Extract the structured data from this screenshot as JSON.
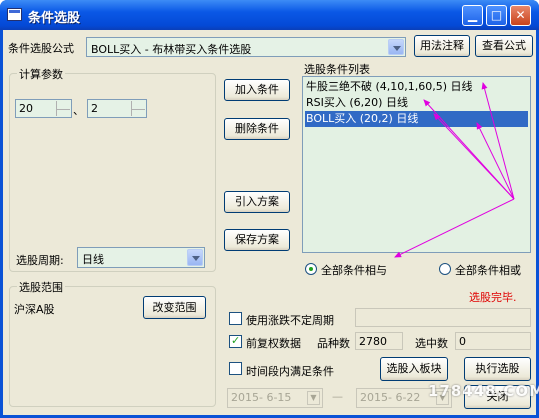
{
  "window": {
    "title": "条件选股"
  },
  "formula": {
    "label": "条件选股公式",
    "value": "BOLL买入   - 布林带买入条件选股",
    "usage_btn": "用法注释",
    "view_btn": "查看公式"
  },
  "calc_params": {
    "title": "计算参数",
    "param1": "20",
    "separator": "、",
    "param2": "2"
  },
  "period": {
    "label": "选股周期:",
    "value": "日线"
  },
  "buttons": {
    "add": "加入条件",
    "delete": "删除条件",
    "import": "引入方案",
    "save": "保存方案",
    "change_range": "改变范围",
    "to_block": "选股入板块",
    "execute": "执行选股",
    "close": "关闭"
  },
  "conditions": {
    "title": "选股条件列表",
    "items": [
      "牛股三绝不破 (4,10,1,60,5) 日线",
      "RSI买入 (6,20) 日线",
      "BOLL买入 (20,2) 日线"
    ],
    "selected_index": 2
  },
  "logic": {
    "all_and": "全部条件相与",
    "all_or": "全部条件相或",
    "selected": "and"
  },
  "status": {
    "text": "选股完毕.",
    "color": "#e00000"
  },
  "range": {
    "title": "选股范围",
    "value": "沪深A股"
  },
  "options": {
    "variable_period": {
      "label": "使用涨跌不定周期",
      "checked": false
    },
    "pre_adjust": {
      "label": "前复权数据",
      "checked": true
    },
    "variety_label": "品种数",
    "variety_value": "2780",
    "selected_label": "选中数",
    "selected_value": "0",
    "time_range": {
      "label": "时间段内满足条件",
      "checked": false
    },
    "date_from": "2015- 6-15",
    "date_to": "2015- 6-22",
    "dash": "—"
  },
  "watermark": "178448.COM"
}
